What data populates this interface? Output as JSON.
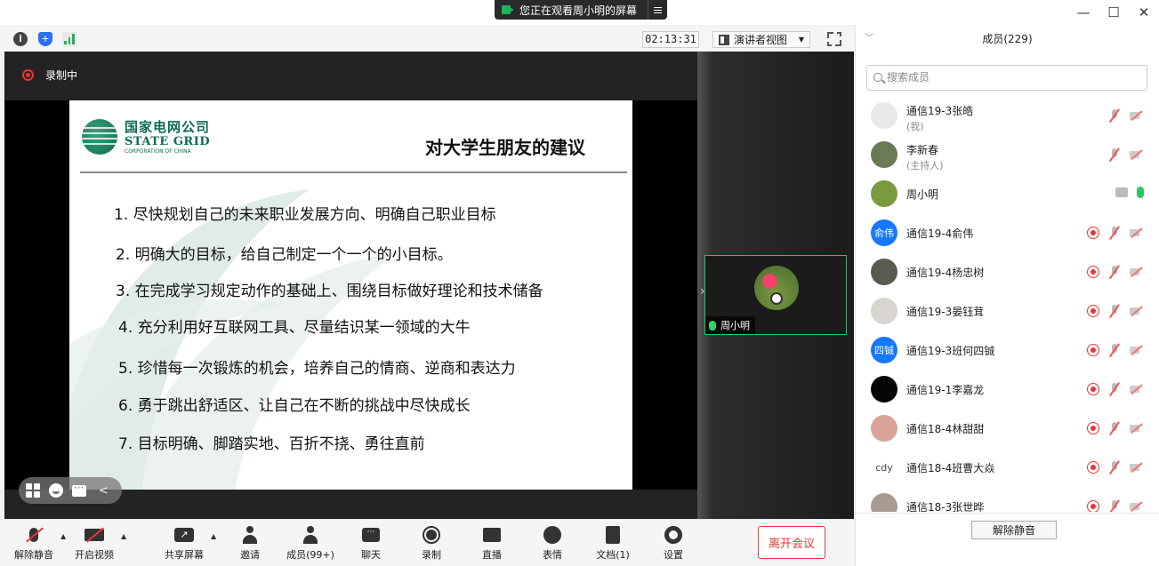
{
  "banner": {
    "text": "您正在观看周小明的屏幕"
  },
  "window": {
    "minimize": "—",
    "maximize": "☐",
    "close": "✕"
  },
  "status": {
    "timer": "02:13:31",
    "view_label": "演讲者视图"
  },
  "recording": {
    "label": "录制中"
  },
  "slide": {
    "logo_cn": "国家电网公司",
    "logo_en": "STATE GRID",
    "logo_sub": "CORPORATION OF CHINA",
    "title": "对大学生朋友的建议",
    "points": [
      "1. 尽快规划自己的未来职业发展方向、明确自己职业目标",
      "2. 明确大的目标，给自己制定一个一个的小目标。",
      "3. 在完成学习规定动作的基础上、围绕目标做好理论和技术储备",
      "4. 充分利用好互联网工具、尽量结识某一领域的大牛",
      "5. 珍惜每一次锻炼的机会，培养自己的情商、逆商和表达力",
      "6. 勇于跳出舒适区、让自己在不断的挑战中尽快成长",
      "7. 目标明确、脚踏实地、百折不挠、勇往直前"
    ]
  },
  "video": {
    "name": "周小明"
  },
  "panel": {
    "title": "成员(229)",
    "search_placeholder": "搜索成员",
    "unmute_all": "解除静音",
    "members": [
      {
        "name": "通信19-3张皓",
        "role": "(我)",
        "avatar_text": "",
        "avatar_color": "#e8e8e8",
        "recording": false,
        "status": "muted"
      },
      {
        "name": "李新春",
        "role": "(主持人)",
        "avatar_text": "",
        "avatar_color": "#6b7a55",
        "recording": false,
        "status": "muted"
      },
      {
        "name": "周小明",
        "role": "",
        "avatar_text": "",
        "avatar_color": "#7a9a40",
        "recording": false,
        "status": "sharing"
      },
      {
        "name": "通信19-4俞伟",
        "role": "",
        "avatar_text": "俞伟",
        "avatar_color": "#1677ff",
        "recording": true,
        "status": "muted"
      },
      {
        "name": "通信19-4杨忠树",
        "role": "",
        "avatar_text": "",
        "avatar_color": "#5a5a50",
        "recording": true,
        "status": "muted"
      },
      {
        "name": "通信19-3晏钰茸",
        "role": "",
        "avatar_text": "",
        "avatar_color": "#d8d4cf",
        "recording": true,
        "status": "muted"
      },
      {
        "name": "通信19-3班何四铖",
        "role": "",
        "avatar_text": "四铖",
        "avatar_color": "#1677ff",
        "recording": true,
        "status": "muted"
      },
      {
        "name": "通信19-1李嘉龙",
        "role": "",
        "avatar_text": "",
        "avatar_color": "#050505",
        "recording": true,
        "status": "muted"
      },
      {
        "name": "通信18-4林甜甜",
        "role": "",
        "avatar_text": "",
        "avatar_color": "#d9a39a",
        "recording": true,
        "status": "muted"
      },
      {
        "name": "通信18-4班曹大焱",
        "role": "",
        "avatar_text": "cdy",
        "avatar_color": "#ffffff",
        "recording": true,
        "status": "muted"
      },
      {
        "name": "通信18-3张世晔",
        "role": "",
        "avatar_text": "",
        "avatar_color": "#a89a90",
        "recording": true,
        "status": "muted"
      }
    ]
  },
  "toolbar": {
    "unmute": "解除静音",
    "start_video": "开启视频",
    "share_screen": "共享屏幕",
    "invite": "邀请",
    "members": "成员(99+)",
    "chat": "聊天",
    "record": "录制",
    "live": "直播",
    "reactions": "表情",
    "documents": "文档(1)",
    "settings": "设置",
    "leave": "离开会议"
  },
  "colors": {
    "accent_green": "#27c46a",
    "leave_red": "#e23b3b",
    "avatar_blue": "#1677ff"
  }
}
